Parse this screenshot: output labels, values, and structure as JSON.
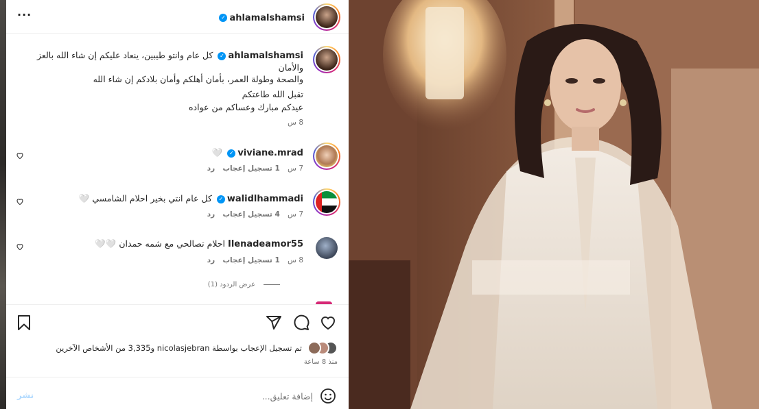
{
  "header": {
    "username": "ahlamalshamsi",
    "more_label": "···"
  },
  "caption": {
    "username": "ahlamalshamsi",
    "line1": "كل عام وانتو طيبين، ينعاد عليكم إن شاء الله بالعز والأمان",
    "line2": "والصحة وطولة العمر، بأمان أهلكم وأمان بلادكم إن شاء الله",
    "line3": "تقبل الله طاعتكم",
    "line4": "عيدكم مبارك وعساكم من عواده",
    "time": "8 س"
  },
  "comments": [
    {
      "username": "viviane.mrad",
      "text": "🤍",
      "time": "7 س",
      "likes": "1 تسجيل إعجاب",
      "reply": "رد",
      "verified": true
    },
    {
      "username": "walidlhammadi",
      "text": "كل عام انتي بخير احلام الشامسي 🤍",
      "time": "7 س",
      "likes": "4 تسجيل إعجاب",
      "reply": "رد",
      "verified": true
    },
    {
      "username": "Ilenadeamor55",
      "text": "احلام تصالحي مع شمه حمدان 🤍🤍",
      "time": "8 س",
      "likes": "1 تسجيل إعجاب",
      "reply": "رد",
      "verified": false
    }
  ],
  "view_replies": "عرض الردود (1)",
  "likes_summary": "تم تسجيل الإعجاب بواسطة nicolasjebran و3,335 من الأشخاص الآخرين",
  "post_time": "منذ 8 ساعة",
  "comment_input": {
    "placeholder": "إضافة تعليق...",
    "post_label": "نشر"
  },
  "colors": {
    "verified": "#0095f6",
    "text": "#262626",
    "meta": "#737373",
    "post_disabled": "#b3dbff"
  }
}
